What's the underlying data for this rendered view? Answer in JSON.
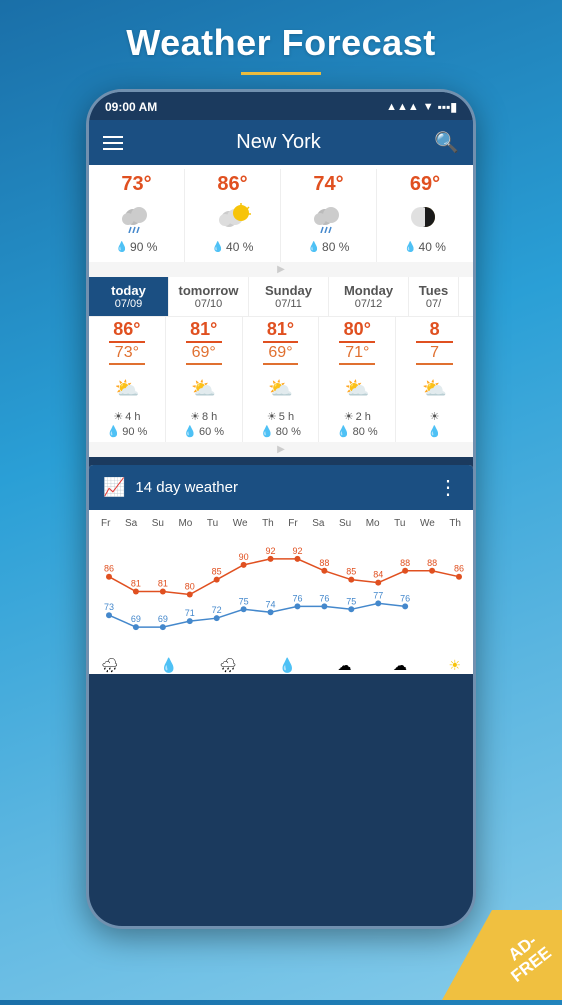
{
  "page": {
    "title": "Weather Forecast",
    "bg_gradient_start": "#1a6fa8",
    "bg_gradient_end": "#85cbea"
  },
  "status_bar": {
    "time": "09:00 AM",
    "signal": "▲▲▲",
    "wifi": "▼",
    "battery": "🔋"
  },
  "nav": {
    "city": "New York",
    "menu_label": "menu",
    "search_label": "search"
  },
  "hourly": {
    "columns": [
      {
        "temp": "73°",
        "icon": "🌧️",
        "rain": "90 %",
        "wind": ""
      },
      {
        "temp": "86°",
        "icon": "⛅",
        "rain": "40 %",
        "wind": ""
      },
      {
        "temp": "74°",
        "icon": "🌧️",
        "rain": "80 %",
        "wind": ""
      },
      {
        "temp": "69°",
        "icon": "🌓",
        "rain": "40 %",
        "wind": ""
      }
    ]
  },
  "daily": {
    "tabs": [
      {
        "name": "today",
        "date": "07/09",
        "active": true
      },
      {
        "name": "tomorrow",
        "date": "07/10",
        "active": false
      },
      {
        "name": "Sunday",
        "date": "07/11",
        "active": false
      },
      {
        "name": "Monday",
        "date": "07/12",
        "active": false
      },
      {
        "name": "Tues",
        "date": "07/",
        "active": false
      }
    ],
    "columns": [
      {
        "high": "86°",
        "low": "73°",
        "sun": "4 h",
        "rain": "90 %"
      },
      {
        "high": "81°",
        "low": "69°",
        "sun": "8 h",
        "rain": "60 %"
      },
      {
        "high": "81°",
        "low": "69°",
        "sun": "5 h",
        "rain": "80 %"
      },
      {
        "high": "80°",
        "low": "71°",
        "sun": "2 h",
        "rain": "80 %"
      },
      {
        "high": "8",
        "low": "7",
        "sun": "",
        "rain": ""
      }
    ]
  },
  "forecast14": {
    "title": "14 day weather",
    "chart_icon": "📈",
    "days": [
      "Fr",
      "Sa",
      "Su",
      "Mo",
      "Tu",
      "We",
      "Th",
      "Fr",
      "Sa",
      "Su",
      "Mo",
      "Tu",
      "We",
      "Th"
    ],
    "high_temps": [
      86,
      81,
      81,
      80,
      85,
      90,
      92,
      92,
      88,
      85,
      84,
      88,
      88,
      86
    ],
    "low_temps": [
      73,
      69,
      69,
      71,
      72,
      75,
      74,
      76,
      76,
      75,
      77,
      76,
      null,
      null
    ],
    "low_dots": [
      73,
      69,
      69,
      71,
      72,
      75,
      74,
      76,
      76,
      75,
      77,
      76
    ],
    "accent_color": "#e05020",
    "line_color_high": "#e05020",
    "line_color_low": "#4488cc"
  },
  "ad_badge": {
    "line1": "AD-",
    "line2": "FREE"
  }
}
